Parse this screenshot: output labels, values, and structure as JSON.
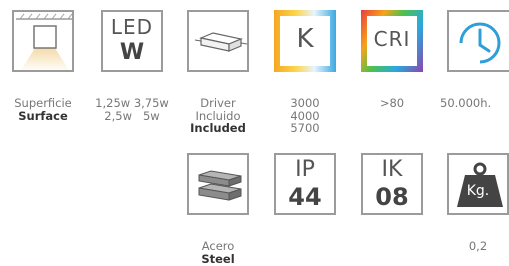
{
  "row1": {
    "surface": {
      "label_es": "Superficie",
      "label_en": "Surface"
    },
    "led": {
      "line1": "LED",
      "line2": "W",
      "powers_row1": [
        "1,25w",
        "3,75w"
      ],
      "powers_row2": [
        "2,5w",
        "5w"
      ]
    },
    "driver": {
      "label_es1": "Driver",
      "label_es2": "Incluido",
      "label_en": "Included"
    },
    "temperature": {
      "symbol": "K",
      "values": [
        "3000",
        "4000",
        "5700"
      ]
    },
    "cri": {
      "symbol": "CRI",
      "value": ">80"
    },
    "lifetime": {
      "value": "50.000h."
    }
  },
  "row2": {
    "material": {
      "label_es": "Acero",
      "label_en": "Steel"
    },
    "ip": {
      "line1": "IP",
      "line2": "44"
    },
    "ik": {
      "line1": "IK",
      "line2": "08"
    },
    "weight": {
      "symbol": "Kg.",
      "value": "0,2"
    }
  },
  "colors": {
    "border": "#9b9b9b",
    "clock": "#2f9fd8",
    "weight_fill": "#444444",
    "light_glow": "#f3d9a6"
  }
}
